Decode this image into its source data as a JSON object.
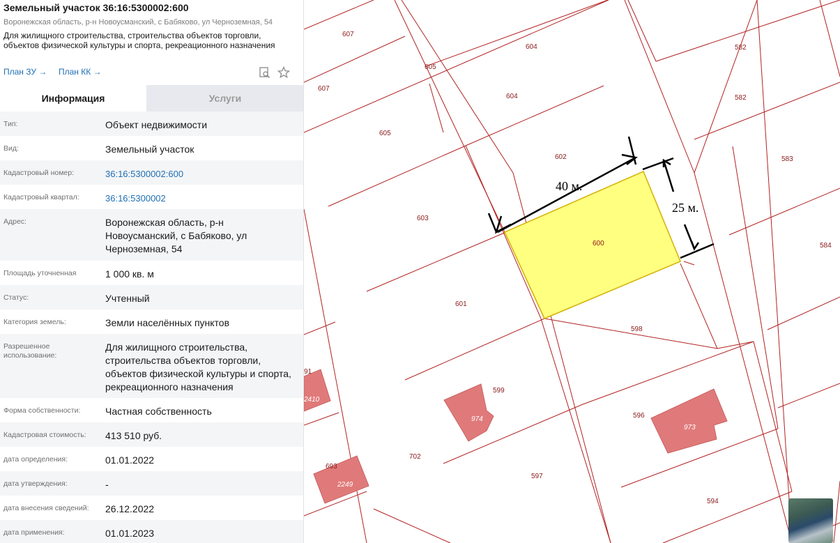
{
  "header": {
    "title": "Земельный участок 36:16:5300002:600",
    "address": "Воронежская область, р-н Новоусманский, с Бабяково, ул Черноземная, 54",
    "usage": "Для жилищного строительства, строительства объектов торговли, объектов физической культуры и спорта, рекреационного назначения",
    "plan_zu": "План ЗУ →",
    "plan_kk": "План КК →",
    "icons": [
      "search-doc-icon",
      "star-icon"
    ]
  },
  "tabs": [
    {
      "label": "Информация",
      "active": true
    },
    {
      "label": "Услуги",
      "active": false
    }
  ],
  "rows": [
    {
      "label": "Тип:",
      "value": "Объект недвижимости"
    },
    {
      "label": "Вид:",
      "value": "Земельный участок"
    },
    {
      "label": "Кадастровый номер:",
      "value": "36:16:5300002:600",
      "link": true
    },
    {
      "label": "Кадастровый квартал:",
      "value": "36:16:5300002",
      "link": true
    },
    {
      "label": "Адрес:",
      "value": "Воронежская область, р-н Новоусманский, с Бабяково, ул Черноземная, 54"
    },
    {
      "label": "Площадь уточненная",
      "value": "1 000 кв. м"
    },
    {
      "label": "Статус:",
      "value": "Учтенный"
    },
    {
      "label": "Категория земель:",
      "value": "Земли населённых пунктов"
    },
    {
      "label": "Разрешенное использование:",
      "value": "Для жилищного строительства, строительства объектов торговли, объектов физической культуры и спорта, рекреационного назначения"
    },
    {
      "label": "Форма собственности:",
      "value": "Частная собственность"
    },
    {
      "label": "Кадастровая стоимость:",
      "value": "413 510 руб."
    },
    {
      "label": "дата определения:",
      "value": "01.01.2022"
    },
    {
      "label": "дата утверждения:",
      "value": "-"
    },
    {
      "label": "дата внесения сведений:",
      "value": "26.12.2022"
    },
    {
      "label": "дата применения:",
      "value": "01.01.2023"
    }
  ],
  "map": {
    "parcel_labels": [
      "607",
      "607",
      "604",
      "604",
      "605",
      "605",
      "582",
      "582",
      "602",
      "583",
      "603",
      "600",
      "584",
      "601",
      "598",
      "599",
      "596",
      "702",
      "597",
      "594",
      "693",
      "91"
    ],
    "building_labels": [
      "974",
      "973",
      "2249",
      "2410"
    ],
    "dimension_labels": [
      "40 м.",
      "25 м."
    ],
    "colors": {
      "boundary": "#b22222",
      "selected_fill": "#ffff80",
      "selected_stroke": "#d4b000",
      "building": "#e07a7a"
    },
    "basemap_thumbnail": "satellite-thumbnail"
  }
}
